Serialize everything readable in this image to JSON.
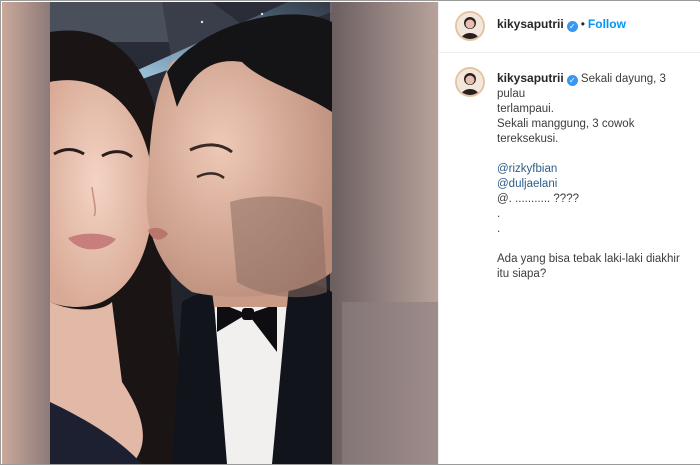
{
  "post": {
    "username": "kikysaputrii",
    "follow_label": "Follow",
    "caption": {
      "line1": "Sekali dayung, 3 pulau",
      "line2": "terlampaui.",
      "line3": "Sekali manggung, 3 cowok",
      "line4": "tereksekusi.",
      "mention1": "@rizkyfbian",
      "mention2": "@duljaelani",
      "line7": "@. ........... ????",
      "line8": ".",
      "line9": ".",
      "line10": "Ada yang bisa tebak laki-laki diakhir",
      "line11": "itu siapa?"
    }
  },
  "icons": {
    "verified": "verified-badge-icon",
    "avatar": "profile-avatar"
  },
  "colors": {
    "follow": "#0095f6",
    "verified": "#3897f0",
    "mention": "#2d5c8a"
  }
}
